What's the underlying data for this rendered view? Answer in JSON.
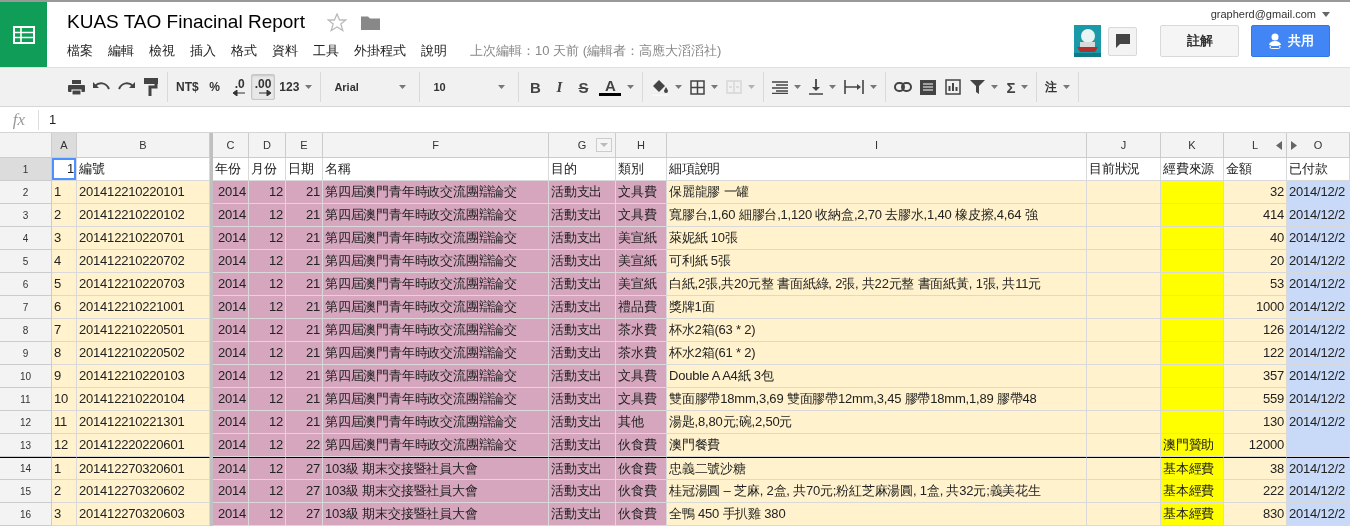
{
  "document": {
    "title": "KUAS TAO Finacinal Report",
    "starred": false,
    "menu": [
      "檔案",
      "編輯",
      "檢視",
      "插入",
      "格式",
      "資料",
      "工具",
      "外掛程式",
      "說明"
    ],
    "last_edit": "上次編輯：10 天前 (編輯者：高應大滔滔社)"
  },
  "account": {
    "email": "grapherd@gmail.com"
  },
  "buttons": {
    "comments": "註解",
    "share": "共用"
  },
  "toolbar": [
    [
      {
        "kind": "print",
        "dropdown": false,
        "pressed": false,
        "disabled": false
      },
      {
        "kind": "undo",
        "dropdown": false,
        "pressed": false,
        "disabled": false
      },
      {
        "kind": "redo",
        "dropdown": false,
        "pressed": false,
        "disabled": false
      },
      {
        "kind": "paint",
        "dropdown": false,
        "pressed": false,
        "disabled": false
      }
    ],
    [
      {
        "kind": "text",
        "label": "NT$",
        "dropdown": false,
        "pressed": false,
        "disabled": false
      },
      {
        "kind": "text",
        "label": "%",
        "dropdown": false,
        "pressed": false,
        "disabled": false
      },
      {
        "kind": "decimal-less",
        "label": ".0",
        "dropdown": false,
        "pressed": false,
        "disabled": false
      },
      {
        "kind": "decimal-more",
        "label": ".00",
        "dropdown": false,
        "pressed": true,
        "disabled": false
      },
      {
        "kind": "text",
        "label": "123",
        "dropdown": true,
        "pressed": false,
        "disabled": false
      }
    ],
    [
      {
        "kind": "select",
        "label": "Arial",
        "dropdown": true,
        "pressed": false,
        "disabled": false
      }
    ],
    [
      {
        "kind": "select",
        "label": "10",
        "dropdown": true,
        "pressed": false,
        "disabled": false
      }
    ],
    [
      {
        "kind": "bold",
        "label": "B",
        "dropdown": false,
        "pressed": false,
        "disabled": false
      },
      {
        "kind": "italic",
        "label": "I",
        "dropdown": false,
        "pressed": false,
        "disabled": false
      },
      {
        "kind": "strike",
        "label": "S",
        "dropdown": false,
        "pressed": false,
        "disabled": false
      },
      {
        "kind": "text-color",
        "label": "A",
        "dropdown": true,
        "pressed": false,
        "disabled": false
      }
    ],
    [
      {
        "kind": "fill",
        "dropdown": true,
        "pressed": false,
        "disabled": false
      },
      {
        "kind": "borders",
        "dropdown": true,
        "pressed": false,
        "disabled": false
      },
      {
        "kind": "merge",
        "dropdown": true,
        "pressed": false,
        "disabled": true
      }
    ],
    [
      {
        "kind": "align",
        "dropdown": true,
        "pressed": false,
        "disabled": false
      },
      {
        "kind": "valign",
        "dropdown": true,
        "pressed": false,
        "disabled": false
      },
      {
        "kind": "wrap",
        "dropdown": true,
        "pressed": false,
        "disabled": false
      }
    ],
    [
      {
        "kind": "link",
        "dropdown": false,
        "pressed": false,
        "disabled": false
      },
      {
        "kind": "comment",
        "dropdown": false,
        "pressed": false,
        "disabled": false
      },
      {
        "kind": "chart",
        "dropdown": false,
        "pressed": false,
        "disabled": false
      },
      {
        "kind": "filter",
        "dropdown": true,
        "pressed": false,
        "disabled": false
      },
      {
        "kind": "sum",
        "label": "Σ",
        "dropdown": true,
        "pressed": false,
        "disabled": false
      }
    ],
    [
      {
        "kind": "text",
        "label": "注",
        "dropdown": true,
        "pressed": false,
        "disabled": false
      }
    ]
  ],
  "formula_bar": {
    "label": "fx",
    "value": "1"
  },
  "sheet": {
    "columns": [
      {
        "letter": "A",
        "selected": true,
        "frozen": true,
        "filter": false,
        "color": "#fff2cc"
      },
      {
        "letter": "B",
        "selected": false,
        "frozen": true,
        "filter": false,
        "color": "#fff2cc"
      },
      {
        "letter": "C",
        "selected": false,
        "frozen": false,
        "filter": false,
        "color": "#d5a6bd"
      },
      {
        "letter": "D",
        "selected": false,
        "frozen": false,
        "filter": false,
        "color": "#d5a6bd"
      },
      {
        "letter": "E",
        "selected": false,
        "frozen": false,
        "filter": false,
        "color": "#d5a6bd"
      },
      {
        "letter": "F",
        "selected": false,
        "frozen": false,
        "filter": false,
        "color": "#d5a6bd"
      },
      {
        "letter": "G",
        "selected": false,
        "frozen": false,
        "filter": true,
        "color": "#d5a6bd"
      },
      {
        "letter": "H",
        "selected": false,
        "frozen": false,
        "filter": false,
        "color": "#d5a6bd"
      },
      {
        "letter": "I",
        "selected": false,
        "frozen": false,
        "filter": false,
        "color": "#fff2cc"
      },
      {
        "letter": "J",
        "selected": false,
        "frozen": false,
        "filter": false,
        "color": "#fff2cc"
      },
      {
        "letter": "K",
        "selected": false,
        "frozen": false,
        "filter": false,
        "color": "#ffff00"
      },
      {
        "letter": "L",
        "selected": false,
        "frozen": false,
        "filter": false,
        "color": "#fff2cc"
      },
      {
        "letter": "O",
        "selected": false,
        "frozen": false,
        "filter": false,
        "color": "#c9daf8"
      }
    ],
    "rows": [
      {
        "number": "1",
        "kind": "header",
        "selected": true,
        "divider_above": false,
        "cells": [
          "1",
          "編號",
          "年份",
          "月份",
          "日期",
          "名稱",
          "目的",
          "類別",
          "細項說明",
          "目前狀況",
          "經費來源",
          "金額",
          "已付款"
        ]
      },
      {
        "number": "2",
        "kind": "data",
        "selected": false,
        "divider_above": false,
        "cells": [
          "1",
          "201412210220101",
          "2014",
          "12",
          "21",
          "第四屆澳門青年時政交流團辯論交",
          "活動支出",
          "文具費",
          "保麗龍膠 一罐",
          "",
          "",
          "32",
          "2014/12/2"
        ]
      },
      {
        "number": "3",
        "kind": "data",
        "selected": false,
        "divider_above": false,
        "cells": [
          "2",
          "201412210220102",
          "2014",
          "12",
          "21",
          "第四屆澳門青年時政交流團辯論交",
          "活動支出",
          "文具費",
          "寬膠台,1,60 細膠台,1,120 收納盒,2,70 去膠水,1,40 橡皮擦,4,64 強",
          "",
          "",
          "414",
          "2014/12/2"
        ]
      },
      {
        "number": "4",
        "kind": "data",
        "selected": false,
        "divider_above": false,
        "cells": [
          "3",
          "201412210220701",
          "2014",
          "12",
          "21",
          "第四屆澳門青年時政交流團辯論交",
          "活動支出",
          "美宣紙",
          "萊妮紙 10張",
          "",
          "",
          "40",
          "2014/12/2"
        ]
      },
      {
        "number": "5",
        "kind": "data",
        "selected": false,
        "divider_above": false,
        "cells": [
          "4",
          "201412210220702",
          "2014",
          "12",
          "21",
          "第四屆澳門青年時政交流團辯論交",
          "活動支出",
          "美宣紙",
          "可利紙 5張",
          "",
          "",
          "20",
          "2014/12/2"
        ]
      },
      {
        "number": "6",
        "kind": "data",
        "selected": false,
        "divider_above": false,
        "cells": [
          "5",
          "201412210220703",
          "2014",
          "12",
          "21",
          "第四屆澳門青年時政交流團辯論交",
          "活動支出",
          "美宣紙",
          "白紙,2張,共20元整 書面紙綠, 2張, 共22元整 書面紙黃, 1張, 共11元",
          "",
          "",
          "53",
          "2014/12/2"
        ]
      },
      {
        "number": "7",
        "kind": "data",
        "selected": false,
        "divider_above": false,
        "cells": [
          "6",
          "201412210221001",
          "2014",
          "12",
          "21",
          "第四屆澳門青年時政交流團辯論交",
          "活動支出",
          "禮品費",
          "獎牌1面",
          "",
          "",
          "1000",
          "2014/12/2"
        ]
      },
      {
        "number": "8",
        "kind": "data",
        "selected": false,
        "divider_above": false,
        "cells": [
          "7",
          "201412210220501",
          "2014",
          "12",
          "21",
          "第四屆澳門青年時政交流團辯論交",
          "活動支出",
          "茶水費",
          "杯水2箱(63 * 2)",
          "",
          "",
          "126",
          "2014/12/2"
        ]
      },
      {
        "number": "9",
        "kind": "data",
        "selected": false,
        "divider_above": false,
        "cells": [
          "8",
          "201412210220502",
          "2014",
          "12",
          "21",
          "第四屆澳門青年時政交流團辯論交",
          "活動支出",
          "茶水費",
          "杯水2箱(61 * 2)",
          "",
          "",
          "122",
          "2014/12/2"
        ]
      },
      {
        "number": "10",
        "kind": "data",
        "selected": false,
        "divider_above": false,
        "cells": [
          "9",
          "201412210220103",
          "2014",
          "12",
          "21",
          "第四屆澳門青年時政交流團辯論交",
          "活動支出",
          "文具費",
          "Double A A4紙 3包",
          "",
          "",
          "357",
          "2014/12/2"
        ]
      },
      {
        "number": "11",
        "kind": "data",
        "selected": false,
        "divider_above": false,
        "cells": [
          "10",
          "201412210220104",
          "2014",
          "12",
          "21",
          "第四屆澳門青年時政交流團辯論交",
          "活動支出",
          "文具費",
          "雙面膠帶18mm,3,69 雙面膠帶12mm,3,45 膠帶18mm,1,89 膠帶48",
          "",
          "",
          "559",
          "2014/12/2"
        ]
      },
      {
        "number": "12",
        "kind": "data",
        "selected": false,
        "divider_above": false,
        "cells": [
          "11",
          "201412210221301",
          "2014",
          "12",
          "21",
          "第四屆澳門青年時政交流團辯論交",
          "活動支出",
          "其他",
          "湯匙,8,80元;碗,2,50元",
          "",
          "",
          "130",
          "2014/12/2"
        ]
      },
      {
        "number": "13",
        "kind": "data",
        "selected": false,
        "divider_above": false,
        "cells": [
          "12",
          "201412220220601",
          "2014",
          "12",
          "22",
          "第四屆澳門青年時政交流團辯論交",
          "活動支出",
          "伙食費",
          "澳門餐費",
          "",
          "澳門贊助",
          "12000",
          ""
        ]
      },
      {
        "number": "14",
        "kind": "data",
        "selected": false,
        "divider_above": true,
        "cells": [
          "1",
          "201412270320601",
          "2014",
          "12",
          "27",
          "103級 期末交接暨社員大會",
          "活動支出",
          "伙食費",
          "忠義二號沙糖",
          "",
          "基本經費",
          "38",
          "2014/12/2"
        ]
      },
      {
        "number": "15",
        "kind": "data",
        "selected": false,
        "divider_above": false,
        "cells": [
          "2",
          "201412270320602",
          "2014",
          "12",
          "27",
          "103級 期末交接暨社員大會",
          "活動支出",
          "伙食費",
          "桂冠湯圓 – 芝麻, 2盒, 共70元;粉紅芝麻湯圓, 1盒, 共32元;義美花生",
          "",
          "基本經費",
          "222",
          "2014/12/2"
        ]
      },
      {
        "number": "16",
        "kind": "data",
        "selected": false,
        "divider_above": false,
        "cells": [
          "3",
          "201412270320603",
          "2014",
          "12",
          "27",
          "103級 期末交接暨社員大會",
          "活動支出",
          "伙食費",
          "全鴨 450 手扒雞 380",
          "",
          "基本經費",
          "830",
          "2014/12/2"
        ]
      }
    ]
  }
}
